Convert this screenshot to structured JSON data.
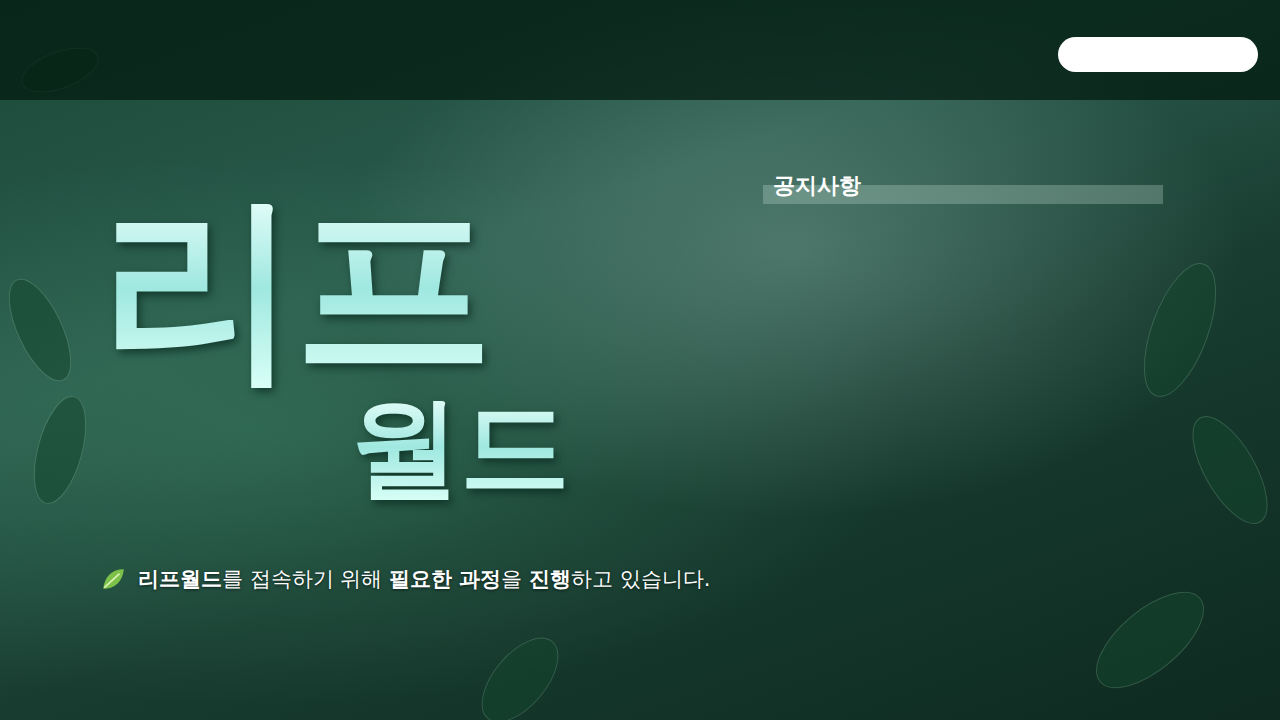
{
  "logo": {
    "top": "리프",
    "bottom": "월드"
  },
  "notice": {
    "title": "공지사항"
  },
  "status": {
    "segments": [
      {
        "text": "리프월드",
        "bold": true
      },
      {
        "text": "를 접속하기 위해 ",
        "bold": false
      },
      {
        "text": "필요한 과정",
        "bold": true
      },
      {
        "text": "을 ",
        "bold": false
      },
      {
        "text": "진행",
        "bold": true
      },
      {
        "text": "하고 있습니다.",
        "bold": false
      }
    ]
  }
}
